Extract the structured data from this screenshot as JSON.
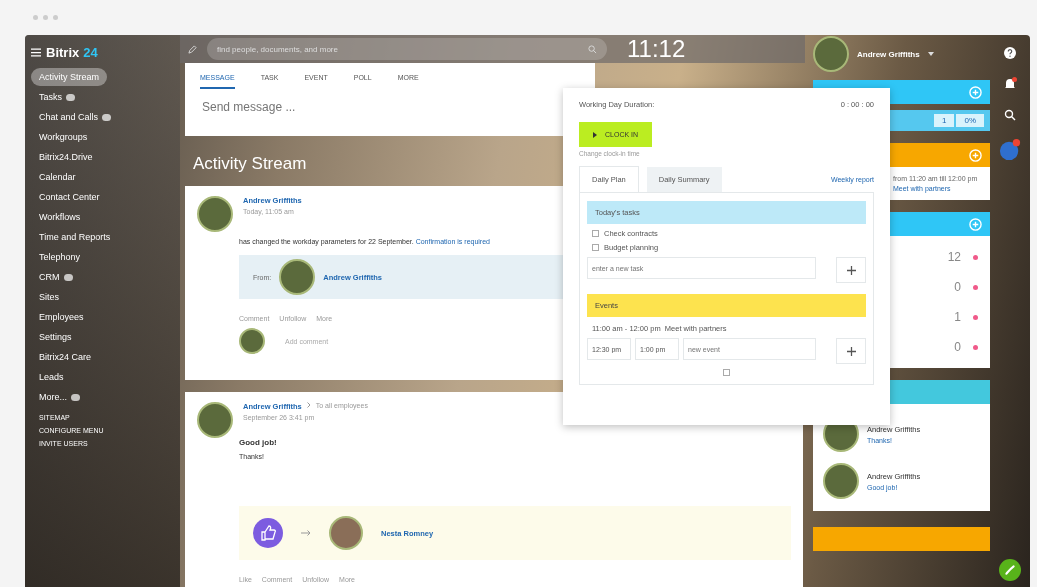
{
  "logo": {
    "name": "Bitrix",
    "suffix": "24"
  },
  "sidebar": {
    "items": [
      {
        "label": "Activity Stream",
        "selected": true,
        "badge": false
      },
      {
        "label": "Tasks",
        "selected": false,
        "badge": true
      },
      {
        "label": "Chat and Calls",
        "selected": false,
        "badge": true
      },
      {
        "label": "Workgroups",
        "selected": false,
        "badge": false
      },
      {
        "label": "Bitrix24.Drive",
        "selected": false,
        "badge": false
      },
      {
        "label": "Calendar",
        "selected": false,
        "badge": false
      },
      {
        "label": "Contact Center",
        "selected": false,
        "badge": false
      },
      {
        "label": "Workflows",
        "selected": false,
        "badge": false
      },
      {
        "label": "Time and Reports",
        "selected": false,
        "badge": false
      },
      {
        "label": "Telephony",
        "selected": false,
        "badge": false
      },
      {
        "label": "CRM",
        "selected": false,
        "badge": true
      },
      {
        "label": "Sites",
        "selected": false,
        "badge": false
      },
      {
        "label": "Employees",
        "selected": false,
        "badge": false
      },
      {
        "label": "Settings",
        "selected": false,
        "badge": false
      },
      {
        "label": "Bitrix24 Care",
        "selected": false,
        "badge": false
      },
      {
        "label": "Leads",
        "selected": false,
        "badge": false
      },
      {
        "label": "More...",
        "selected": false,
        "badge": true
      }
    ],
    "footer_links": [
      "SITEMAP",
      "CONFIGURE MENU",
      "INVITE USERS"
    ]
  },
  "header": {
    "search_placeholder": "find people, documents, and more",
    "clock": "11:12"
  },
  "composer": {
    "tabs": [
      {
        "label": "MESSAGE",
        "selected": true
      },
      {
        "label": "TASK",
        "selected": false
      },
      {
        "label": "EVENT",
        "selected": false
      },
      {
        "label": "POLL",
        "selected": false
      },
      {
        "label": "MORE",
        "selected": false
      }
    ],
    "placeholder": "Send message ..."
  },
  "page_title": "Activity Stream",
  "posts": [
    {
      "kind": "workday",
      "author": "Andrew Griffiths",
      "time": "Today, 11:05 am",
      "text": "has changed the workday parameters for 22 September.",
      "link": "Confirmation is required",
      "from_label": "From:",
      "from_name": "Andrew Griffiths",
      "actions": [
        "Comment",
        "Unfollow",
        "More"
      ],
      "add_comment": "Add comment"
    },
    {
      "kind": "gratitude",
      "author": "Andrew Griffiths",
      "recipient": "To all employees",
      "time": "September 26 3:41 pm",
      "title": "Good job!",
      "text": "Thanks!",
      "thanked": "Nesta Romney",
      "actions": [
        "Like",
        "Comment",
        "Unfollow",
        "More"
      ]
    }
  ],
  "workday_popup": {
    "duration_label": "Working Day Duration:",
    "duration": "0 : 00 : 00",
    "clock_in": "CLOCK IN",
    "change_time": "Change clock-in time",
    "tabs": [
      {
        "label": "Daily Plan",
        "selected": true
      },
      {
        "label": "Daily Summary",
        "selected": false
      }
    ],
    "report_link": "Weekly report",
    "tasks_title": "Today's tasks",
    "tasks": [
      {
        "label": "Check contracts",
        "checked": false
      },
      {
        "label": "Budget planning",
        "checked": false
      }
    ],
    "task_placeholder": "enter a new task",
    "events_title": "Events",
    "events": [
      {
        "time": "11:00 am - 12:00 pm",
        "title": "Meet with partners"
      }
    ],
    "new_event": {
      "start": "12:30 pm",
      "end": "1:00 pm",
      "placeholder": "new event",
      "private_checked": false
    }
  },
  "right_panel": {
    "user": "Andrew Griffiths",
    "task_counter": {
      "value": "1",
      "percent": "0%"
    },
    "event_text": "from 11:20 am till 12:00 pm",
    "event_link": "Meet with partners",
    "counters": [
      "12",
      "0",
      "1",
      "0"
    ],
    "comments": [
      {
        "author": "Andrew Griffiths",
        "text": "Thanks!"
      },
      {
        "author": "Andrew Griffiths",
        "text": "Good job!"
      }
    ]
  }
}
